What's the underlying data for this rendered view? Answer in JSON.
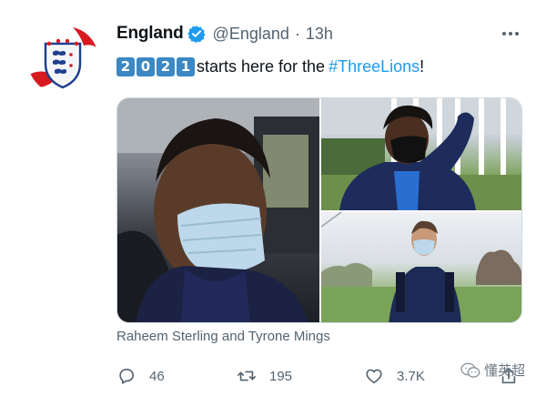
{
  "account": {
    "display_name": "England",
    "handle": "@England",
    "separator": "·",
    "time": "13h",
    "verified_icon": "verified-badge-icon",
    "avatar_icon": "three-lions-crest-icon"
  },
  "tweet": {
    "year_digits": [
      "2",
      "0",
      "2",
      "1"
    ],
    "text_middle": "starts here for the",
    "hashtag": "#ThreeLions",
    "text_end": "!"
  },
  "media": {
    "caption": "Raheem Sterling and Tyrone Mings",
    "photos": [
      "player-close-up-photo",
      "player-in-mask-photo",
      "player-walking-photo"
    ]
  },
  "actions": {
    "replies": "46",
    "retweets": "195",
    "likes": "3.7K"
  },
  "watermark": {
    "text": "懂英超"
  },
  "colors": {
    "accent": "#1d9bf0",
    "text_primary": "#0f1419",
    "text_secondary": "#536471",
    "keycap_blue": "#3b88c3",
    "crest_red": "#d71920",
    "crest_blue": "#1f3f8f"
  }
}
